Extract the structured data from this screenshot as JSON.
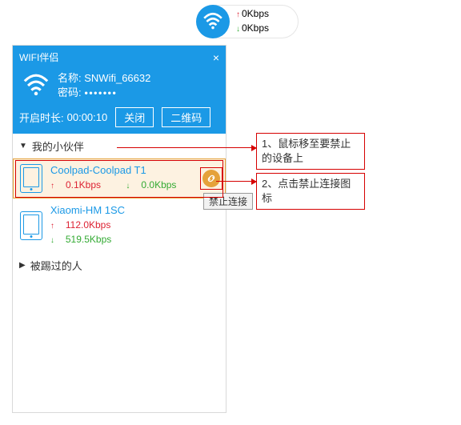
{
  "pill": {
    "up": "0Kbps",
    "down": "0Kbps"
  },
  "panel": {
    "title": "WIFI伴侣",
    "nameLabel": "名称:",
    "name": "SNWifi_66632",
    "pwdLabel": "密码:",
    "pwdMask": "●●●●●●●",
    "durationLabel": "开启时长:",
    "duration": "00:00:10",
    "closeBtn": "关闭",
    "qrBtn": "二维码"
  },
  "sections": {
    "partners": "我的小伙伴",
    "kicked": "被踢过的人"
  },
  "devices": [
    {
      "name": "Coolpad-Coolpad T1",
      "up": "0.1Kbps",
      "down": "0.0Kbps",
      "hover": true
    },
    {
      "name": "Xiaomi-HM 1SC",
      "up": "112.0Kbps",
      "down": "519.5Kbps",
      "hover": false
    }
  ],
  "tooltip": "禁止连接",
  "annotations": {
    "a1": "1、鼠标移至要禁止的设备上",
    "a2": "2、点击禁止连接图标"
  }
}
